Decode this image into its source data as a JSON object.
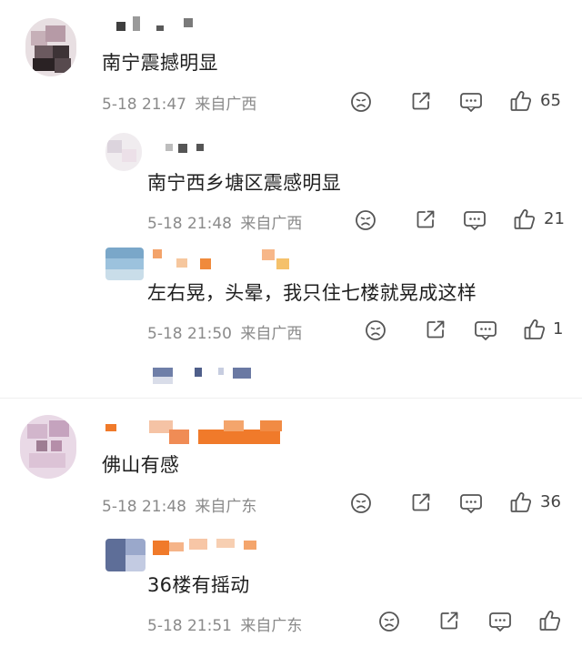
{
  "colors": {
    "text": "#1f1f1f",
    "meta": "#8a8a8a",
    "icon": "#555555",
    "divider": "#efefef",
    "username_orange": "#f07a2a"
  },
  "comments": [
    {
      "text": "南宁震撼明显",
      "time": "5-18 21:47",
      "location": "来自广西",
      "likes": "65",
      "replies": [
        {
          "text": "南宁西乡塘区震感明显",
          "time": "5-18 21:48",
          "location": "来自广西",
          "likes": "21"
        },
        {
          "text": "左右晃，头晕，我只住七楼就晃成这样",
          "time": "5-18 21:50",
          "location": "来自广西",
          "likes": "1"
        }
      ]
    },
    {
      "text": "佛山有感",
      "time": "5-18 21:48",
      "location": "来自广东",
      "likes": "36",
      "replies": [
        {
          "text": "36楼有摇动",
          "time": "5-18 21:51",
          "location": "来自广东",
          "likes": ""
        }
      ]
    }
  ],
  "icons": {
    "sad": "sad-face-icon",
    "share": "share-icon",
    "comment": "comment-icon",
    "like": "thumbs-up-icon"
  }
}
